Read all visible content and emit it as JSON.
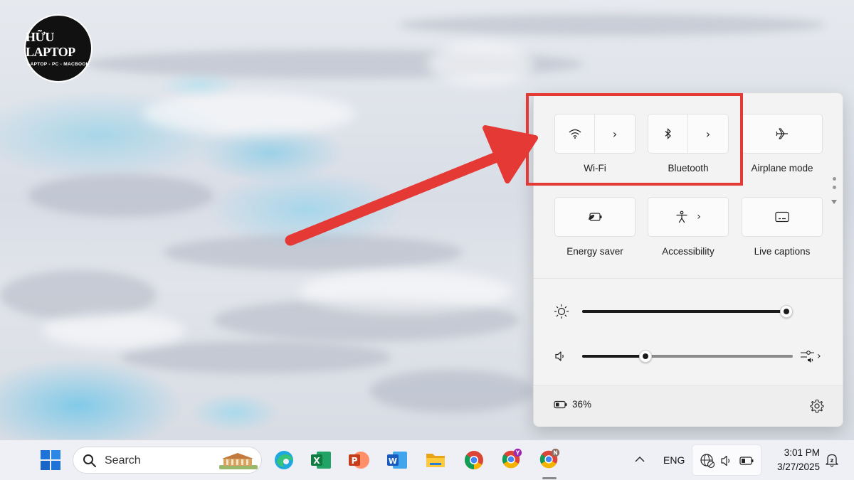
{
  "logo": {
    "name": "HỮU LAPTOP",
    "tagline": "LAPTOP - PC - MACBOOK"
  },
  "quick_settings": {
    "tiles": [
      {
        "id": "wifi",
        "label": "Wi-Fi",
        "icon": "wifi-icon",
        "expandable": true
      },
      {
        "id": "bluetooth",
        "label": "Bluetooth",
        "icon": "bluetooth-icon",
        "expandable": true
      },
      {
        "id": "airplane",
        "label": "Airplane mode",
        "icon": "airplane-icon",
        "expandable": false
      },
      {
        "id": "energy",
        "label": "Energy saver",
        "icon": "energy-saver-icon",
        "expandable": false
      },
      {
        "id": "accessibility",
        "label": "Accessibility",
        "icon": "accessibility-icon",
        "expandable": true
      },
      {
        "id": "captions",
        "label": "Live captions",
        "icon": "live-captions-icon",
        "expandable": false
      }
    ],
    "brightness": {
      "icon": "brightness-icon",
      "level": 1.0
    },
    "volume": {
      "icon": "speaker-icon",
      "level": 0.3,
      "mixer_icon": "sound-mixer-icon"
    },
    "battery": {
      "icon": "battery-icon",
      "percent": "36%"
    },
    "settings_icon": "gear-icon"
  },
  "taskbar": {
    "search_placeholder": "Search",
    "apps": [
      "start-icon",
      "edge-icon",
      "excel-icon",
      "powerpoint-icon",
      "word-icon",
      "file-explorer-icon",
      "chrome-icon",
      "chrome-profile-y-icon",
      "chrome-profile-n-icon"
    ],
    "language": "ENG",
    "time": "3:01 PM",
    "date": "3/27/2025"
  },
  "colors": {
    "highlight": "#e53935",
    "arrow": "#e53935",
    "panel": "#f3f3f3",
    "taskbar": "#eef0f5"
  }
}
